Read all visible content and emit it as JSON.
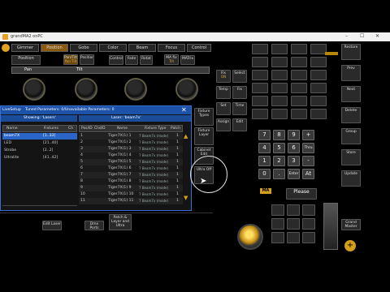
{
  "window": {
    "title": "grandMA2 onPC",
    "controls": [
      "–",
      "☐",
      "✕"
    ]
  },
  "top_tabs": [
    "Gimmer",
    "Position",
    "Gobo",
    "Color",
    "Beam",
    "Focus",
    "Control"
  ],
  "preset_row1": [
    {
      "label": "Position",
      "sub": ""
    },
    {
      "label": "Pan/Tilt",
      "sub": "Pan Tilt"
    },
    {
      "label": "Position",
      "sub": ""
    },
    {
      "label": "Control",
      "sub": ""
    },
    {
      "label": "Fade",
      "sub": ""
    },
    {
      "label": "Rotat",
      "sub": ""
    },
    {
      "label": "MA fix",
      "sub": "Tilt"
    },
    {
      "label": "MATrix",
      "sub": ""
    }
  ],
  "encoder_labels": [
    "Pan",
    "Tilt"
  ],
  "encoder_values": [
    "",
    "",
    "",
    ""
  ],
  "dialog": {
    "header_left": "LiveSetup",
    "header_mid": "Tuned Parameters: 0/Unavailable Parameters: 0",
    "close": "✕",
    "showing": "Showing: 'Lasers'",
    "layer": "Laser: 'beam7x'",
    "left_columns": [
      "Name",
      "Fixtures",
      "Ch"
    ],
    "left_rows": [
      {
        "name": "beam7X",
        "fixtures": "[1..33]",
        "ch": ""
      },
      {
        "name": "LED",
        "fixtures": "[21..40]",
        "ch": ""
      },
      {
        "name": "Strobe",
        "fixtures": "[2..2]",
        "ch": ""
      },
      {
        "name": "Ultralite",
        "fixtures": "[41..42]",
        "ch": ""
      }
    ],
    "right_columns": [
      "Pos/ID",
      "Chd/D",
      "Name",
      "Fixture Type",
      "Patch"
    ],
    "right_rows": [
      {
        "id": "1",
        "name": "Tiger7X(1) 1",
        "type": "7 Beam7x (mode)",
        "patch": "1"
      },
      {
        "id": "2",
        "name": "Tiger7X(1) 2",
        "type": "7 Beam7x (mode)",
        "patch": "1"
      },
      {
        "id": "3",
        "name": "Tiger7X(1) 3",
        "type": "7 Beam7x (mode)",
        "patch": "1"
      },
      {
        "id": "4",
        "name": "Tiger7X(1) 4",
        "type": "7 Beam7x (mode)",
        "patch": "1"
      },
      {
        "id": "5",
        "name": "Tiger7X(1) 5",
        "type": "7 Beam7x (mode)",
        "patch": "1"
      },
      {
        "id": "6",
        "name": "Tiger7X(1) 6",
        "type": "7 Beam7x (mode)",
        "patch": "1"
      },
      {
        "id": "7",
        "name": "Tiger7X(1) 7",
        "type": "7 Beam7x (mode)",
        "patch": "1"
      },
      {
        "id": "8",
        "name": "Tiger7X(1) 8",
        "type": "7 Beam7x (mode)",
        "patch": "1"
      },
      {
        "id": "9",
        "name": "Tiger7X(1) 9",
        "type": "7 Beam7x (mode)",
        "patch": "1"
      },
      {
        "id": "10",
        "name": "Tiger7X(1) 10",
        "type": "7 Beam7x (mode)",
        "patch": "1"
      },
      {
        "id": "11",
        "name": "Tiger7X(1) 11",
        "type": "7 Beam7x (mode)",
        "patch": "1"
      }
    ],
    "side_buttons": [
      "Fixture Types",
      "Fixture Layer",
      "",
      "Cabinet Edit",
      "Ultra Off"
    ]
  },
  "bottom_buttons": [
    "",
    "Edit Laser",
    "",
    "Dmx Ports",
    "Patch & Layer and Ultra",
    "",
    "Extend",
    ""
  ],
  "console_left_col": [
    {
      "label": "Fix",
      "sub": "ON"
    },
    {
      "label": "Select",
      "sub": ""
    },
    {
      "label": "Temp",
      "sub": ""
    },
    {
      "label": "Fix",
      "sub": ""
    },
    {
      "label": "Set",
      "sub": ""
    },
    {
      "label": "Time",
      "sub": ""
    },
    {
      "label": "Assign",
      "sub": ""
    },
    {
      "label": "Edit",
      "sub": ""
    }
  ],
  "numpad": [
    [
      "7",
      "8",
      "9",
      "+"
    ],
    [
      "4",
      "5",
      "6",
      "Thru"
    ],
    [
      "1",
      "2",
      "3",
      "-"
    ],
    [
      "0",
      ".",
      "Enter",
      "At"
    ]
  ],
  "please": "Please",
  "right_strip": [
    "Restore",
    "Prev",
    "Next",
    "Delete",
    "Group",
    "Store",
    "Update"
  ],
  "master": {
    "label": "Grand Master",
    "value": "100"
  },
  "colors": {
    "accent": "#d4a019",
    "dialog_header": "#1c52a8",
    "highlight": "#2a65c8",
    "bg": "#000000"
  }
}
